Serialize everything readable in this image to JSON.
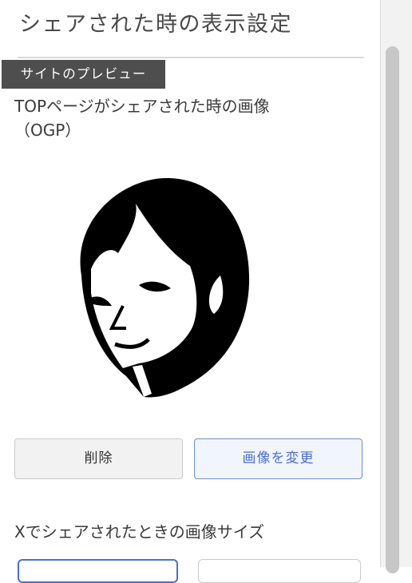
{
  "panel": {
    "heading": "シェアされた時の表示設定",
    "tooltip": "サイトのプレビュー",
    "ogp": {
      "title_line1": "TOPページがシェアされた時の画像",
      "title_line2": "（OGP）",
      "image_icon": "woman-face-illustration"
    },
    "buttons": {
      "delete_label": "削除",
      "change_label": "画像を変更"
    },
    "x_image_size": {
      "title": "Xでシェアされたときの画像サイズ"
    }
  },
  "colors": {
    "accent": "#4a6fd0",
    "tooltip_bg": "#4e4e4e",
    "divider": "#d9d9d9"
  }
}
